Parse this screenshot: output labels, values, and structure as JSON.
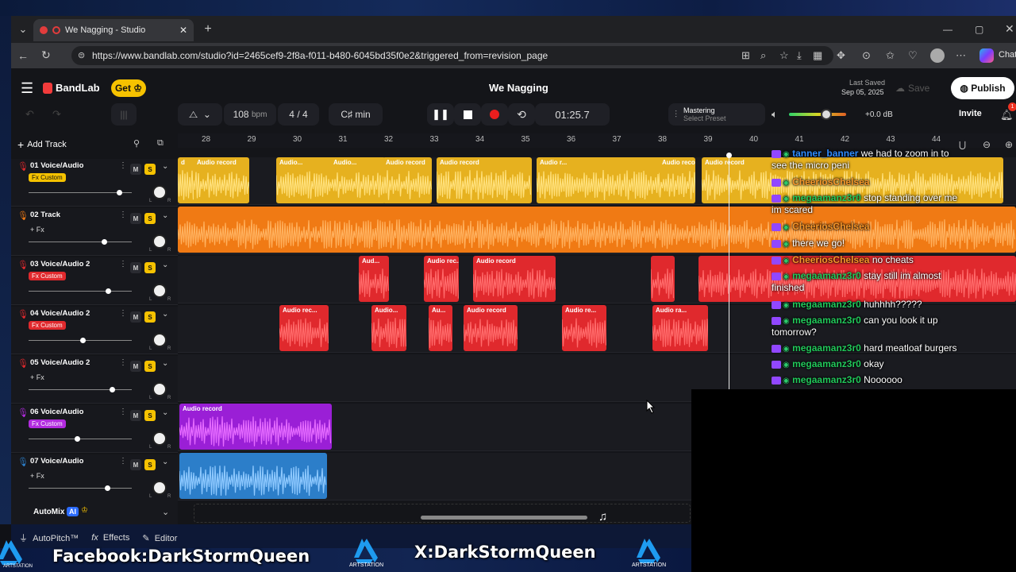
{
  "browser": {
    "tab_title": "We Nagging - Studio",
    "url": "https://www.bandlab.com/studio?id=2465cef9-2f8a-f011-b480-6045bd35f0e2&triggered_from=revision_page",
    "chat_label": "Chat"
  },
  "app": {
    "brand": "BandLab",
    "get_label": "Get",
    "project_title": "We Nagging",
    "last_saved_label": "Last Saved",
    "last_saved_date": "Sep 05, 2025",
    "save_label": "Save",
    "publish_label": "Publish",
    "invite_label": "Invite",
    "notifications_count": "1"
  },
  "transport": {
    "bpm_value": "108",
    "bpm_unit": "bpm",
    "time_sig_num": "4",
    "time_sig_den": "4",
    "key": "C♯ min",
    "time": "01:25.7",
    "mastering_label": "Mastering",
    "mastering_preset": "Select Preset",
    "master_volume": "+0.0 dB",
    "master_volume_level": 0.65
  },
  "toolbar": {
    "add_track_label": "Add Track"
  },
  "ruler": [
    "28",
    "29",
    "30",
    "31",
    "32",
    "33",
    "34",
    "35",
    "36",
    "37",
    "38",
    "39",
    "40",
    "41",
    "42",
    "43",
    "44"
  ],
  "tracks": [
    {
      "name": "01  Voice/Audio",
      "fx": "Fx Custom",
      "fx_style": "yellow",
      "color": "#e6b11f",
      "mute": "M",
      "solo": "S",
      "volume": 0.88,
      "clips": [
        "d",
        "Audio record",
        "Audio...",
        "Audio...",
        "Audio record",
        "Audio record",
        "Audio r...",
        "Audio record",
        "Audio record"
      ]
    },
    {
      "name": "02  Track",
      "fx": "+ Fx",
      "fx_style": "plain",
      "color": "#f07a14",
      "mute": "M",
      "solo": "S",
      "volume": 0.73,
      "clips": []
    },
    {
      "name": "03  Voice/Audio 2",
      "fx": "Fx Custom",
      "fx_style": "red",
      "color": "#e0292d",
      "mute": "M",
      "solo": "S",
      "volume": 0.77,
      "clips": [
        "Aud...",
        "Audio rec...",
        "Audio record"
      ]
    },
    {
      "name": "04  Voice/Audio 2",
      "fx": "Fx Custom",
      "fx_style": "red",
      "color": "#e0292d",
      "mute": "M",
      "solo": "S",
      "volume": 0.52,
      "clips": [
        "Audio rec...",
        "Audio...",
        "Au...",
        "Audio record",
        "Audio re...",
        "Audio ra..."
      ]
    },
    {
      "name": "05  Voice/Audio 2",
      "fx": "+ Fx",
      "fx_style": "plain",
      "color": "#e0292d",
      "mute": "M",
      "solo": "S",
      "volume": 0.81,
      "clips": []
    },
    {
      "name": "06  Voice/Audio",
      "fx": "Fx Custom",
      "fx_style": "purple",
      "color": "#9a1fd6",
      "mute": "M",
      "solo": "S",
      "volume": 0.47,
      "clips": [
        "Audio record"
      ]
    },
    {
      "name": "07  Voice/Audio",
      "fx": "+ Fx",
      "fx_style": "plain",
      "color": "#2c7ec9",
      "mute": "M",
      "solo": "S",
      "volume": 0.76,
      "clips": []
    }
  ],
  "automix": {
    "label": "AutoMix",
    "ai": "AI"
  },
  "bottom_tools": {
    "autopitch": "AutoPitch™",
    "effects": "Effects",
    "editor": "Editor"
  },
  "chat": [
    {
      "user": "tanner_banner",
      "style": "b",
      "text": "we had to zoom in to",
      "cont": "see the micro peni"
    },
    {
      "user": "CheeriosChelsea",
      "style": "o",
      "text": "",
      "cont": ""
    },
    {
      "user": "megaamanz3r0",
      "style": "g",
      "text": "stop standing over me",
      "cont": "im scared"
    },
    {
      "user": "CheeriosChelsea",
      "style": "o",
      "text": "",
      "cont": ""
    },
    {
      "user": "",
      "style": "o",
      "text": "there we go!",
      "cont": ""
    },
    {
      "user": "CheeriosChelsea",
      "style": "o",
      "text": "no cheats",
      "cont": ""
    },
    {
      "user": "megaamanz3r0",
      "style": "g",
      "text": "stay still im almost",
      "cont": "finished"
    },
    {
      "user": "megaamanz3r0",
      "style": "g",
      "text": "huhhhh?????",
      "cont": ""
    },
    {
      "user": "megaamanz3r0",
      "style": "g",
      "text": "can you look it up",
      "cont": "tomorrow?"
    },
    {
      "user": "megaamanz3r0",
      "style": "g",
      "text": "hard meatloaf burgers",
      "cont": ""
    },
    {
      "user": "megaamanz3r0",
      "style": "g",
      "text": "okay",
      "cont": ""
    },
    {
      "user": "megaamanz3r0",
      "style": "g",
      "text": "Noooooo",
      "cont": ""
    }
  ],
  "overlay": {
    "facebook": "Facebook:DarkStormQueen",
    "x": "X:DarkStormQueen",
    "artstation": "ARTSTATION"
  }
}
